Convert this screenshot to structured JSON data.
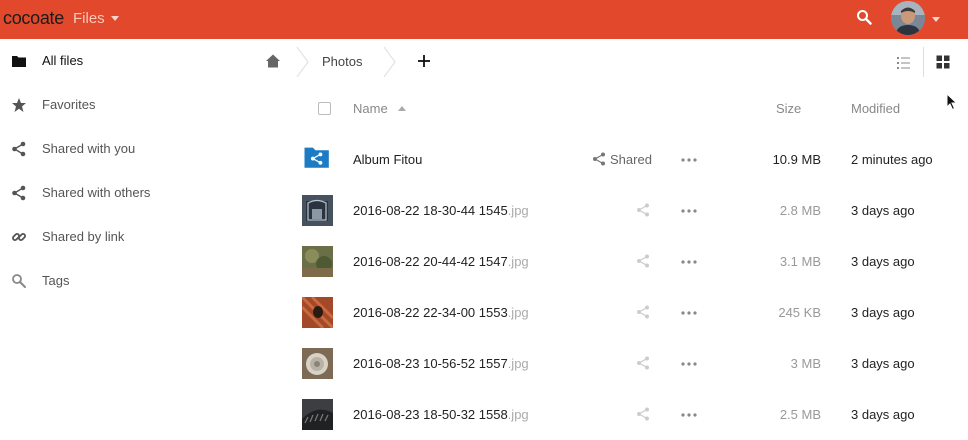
{
  "topbar": {
    "logo": "cocoate",
    "app_name": "Files",
    "brand_color": "#e2492c"
  },
  "sidebar": {
    "items": [
      {
        "label": "All files",
        "icon": "folder-icon"
      },
      {
        "label": "Favorites",
        "icon": "star-icon"
      },
      {
        "label": "Shared with you",
        "icon": "share-icon"
      },
      {
        "label": "Shared with others",
        "icon": "share-icon"
      },
      {
        "label": "Shared by link",
        "icon": "link-icon"
      },
      {
        "label": "Tags",
        "icon": "search-icon"
      }
    ]
  },
  "breadcrumb": {
    "current": "Photos"
  },
  "table": {
    "headers": {
      "name": "Name",
      "size": "Size",
      "modified": "Modified"
    },
    "rows": [
      {
        "name": "Album Fitou",
        "ext": "",
        "size": "10.9 MB",
        "modified": "2 minutes ago",
        "shared_label": "Shared",
        "type": "shared-folder"
      },
      {
        "name": "2016-08-22 18-30-44 1545",
        "ext": ".jpg",
        "size": "2.8 MB",
        "modified": "3 days ago",
        "type": "image"
      },
      {
        "name": "2016-08-22 20-44-42 1547",
        "ext": ".jpg",
        "size": "3.1 MB",
        "modified": "3 days ago",
        "type": "image"
      },
      {
        "name": "2016-08-22 22-34-00 1553",
        "ext": ".jpg",
        "size": "245 KB",
        "modified": "3 days ago",
        "type": "image"
      },
      {
        "name": "2016-08-23 10-56-52 1557",
        "ext": ".jpg",
        "size": "3 MB",
        "modified": "3 days ago",
        "type": "image"
      },
      {
        "name": "2016-08-23 18-50-32 1558",
        "ext": ".jpg",
        "size": "2.5 MB",
        "modified": "3 days ago",
        "type": "image"
      }
    ]
  }
}
